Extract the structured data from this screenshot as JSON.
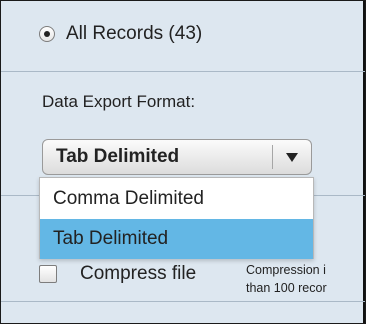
{
  "records": {
    "all_records_label": "All Records (43)",
    "selected": true
  },
  "export": {
    "format_label": "Data Export Format:",
    "selected_value": "Tab Delimited",
    "options": [
      {
        "label": "Comma Delimited",
        "highlighted": false
      },
      {
        "label": "Tab Delimited",
        "highlighted": true
      }
    ]
  },
  "compress": {
    "label": "Compress file",
    "checked": false,
    "note_line1": "Compression i",
    "note_line2": "than 100 recor"
  },
  "colors": {
    "panel_bg": "#dde7f0",
    "highlight": "#63b7e5",
    "text": "#222222"
  }
}
